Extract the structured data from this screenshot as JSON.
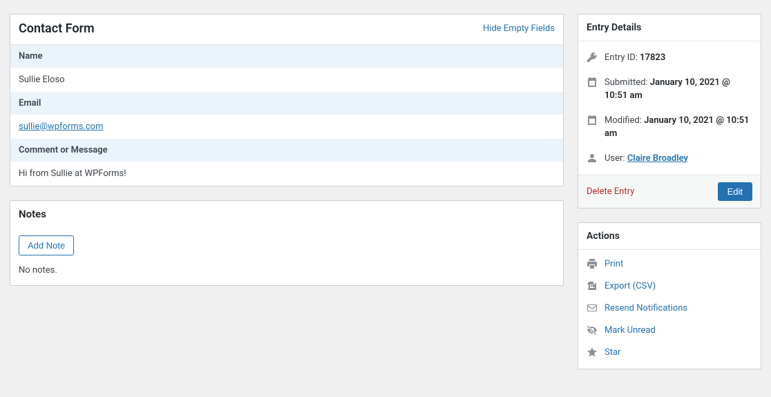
{
  "form": {
    "title": "Contact Form",
    "hide_empty_label": "Hide Empty Fields",
    "fields": {
      "name_label": "Name",
      "name_value": "Sullie Eloso",
      "email_label": "Email",
      "email_value": "sullie@wpforms.com",
      "comment_label": "Comment or Message",
      "comment_value": "Hi from Sullie at WPForms!"
    }
  },
  "notes": {
    "title": "Notes",
    "add_label": "Add Note",
    "empty_text": "No notes."
  },
  "details": {
    "title": "Entry Details",
    "entry_id_label": "Entry ID: ",
    "entry_id_value": "17823",
    "submitted_label": "Submitted: ",
    "submitted_value": "January 10, 2021 @ 10:51 am",
    "modified_label": "Modified: ",
    "modified_value": "January 10, 2021 @ 10:51 am",
    "user_label": "User: ",
    "user_value": "Claire Broadley",
    "delete_label": "Delete Entry",
    "edit_label": "Edit"
  },
  "actions": {
    "title": "Actions",
    "print": "Print",
    "export": "Export (CSV)",
    "resend": "Resend Notifications",
    "mark_unread": "Mark Unread",
    "star": "Star"
  }
}
